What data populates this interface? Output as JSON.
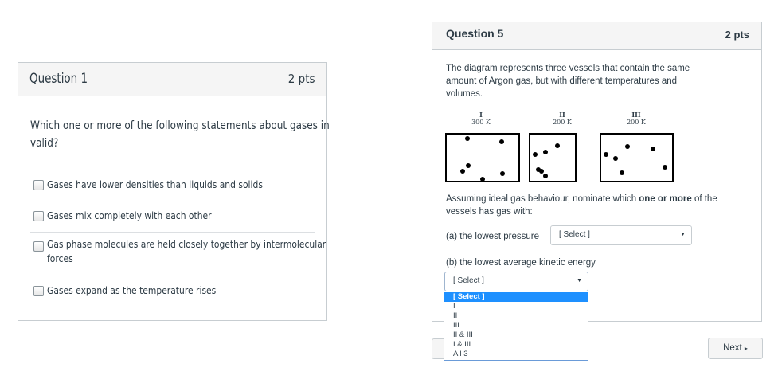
{
  "question1": {
    "title": "Question 1",
    "points": "2 pts",
    "text_line1": "Which one or more of the following statements about gases in",
    "text_line2": "valid?",
    "answers": [
      {
        "label": "Gases have lower densities than liquids and solids"
      },
      {
        "label": "Gases mix completely with each other"
      },
      {
        "label_line1": "Gas phase molecules are held closely together by intermolecular",
        "label_line2": "forces"
      },
      {
        "label": "Gases expand as the temperature rises"
      }
    ]
  },
  "question5": {
    "title": "Question 5",
    "points": "2 pts",
    "desc_line1": "The diagram represents three vessels that contain the same",
    "desc_line2": "amount of Argon gas, but with different temperatures and",
    "desc_line3": "volumes.",
    "vessels": [
      {
        "roman": "I",
        "temp": "300 K"
      },
      {
        "roman": "II",
        "temp": "200 K"
      },
      {
        "roman": "III",
        "temp": "200 K"
      }
    ],
    "assume_pre": "Assuming ideal gas behaviour, nominate which ",
    "assume_bold": "one or more",
    "assume_post": " of the",
    "assume_line2": "vessels has gas with:",
    "part_a": "(a) the lowest pressure",
    "part_a_select": "[ Select ]",
    "part_b": "(b) the lowest average kinetic energy",
    "part_b_select": "[ Select ]",
    "dropdown_options": [
      "[ Select ]",
      "I",
      "II",
      "III",
      "II & III",
      "I & III",
      "All 3"
    ]
  },
  "nav": {
    "next_label": "Next",
    "next_icon": "▸"
  },
  "colors": {
    "selected_option": "#1e90ff",
    "border": "#c7cdd1"
  }
}
